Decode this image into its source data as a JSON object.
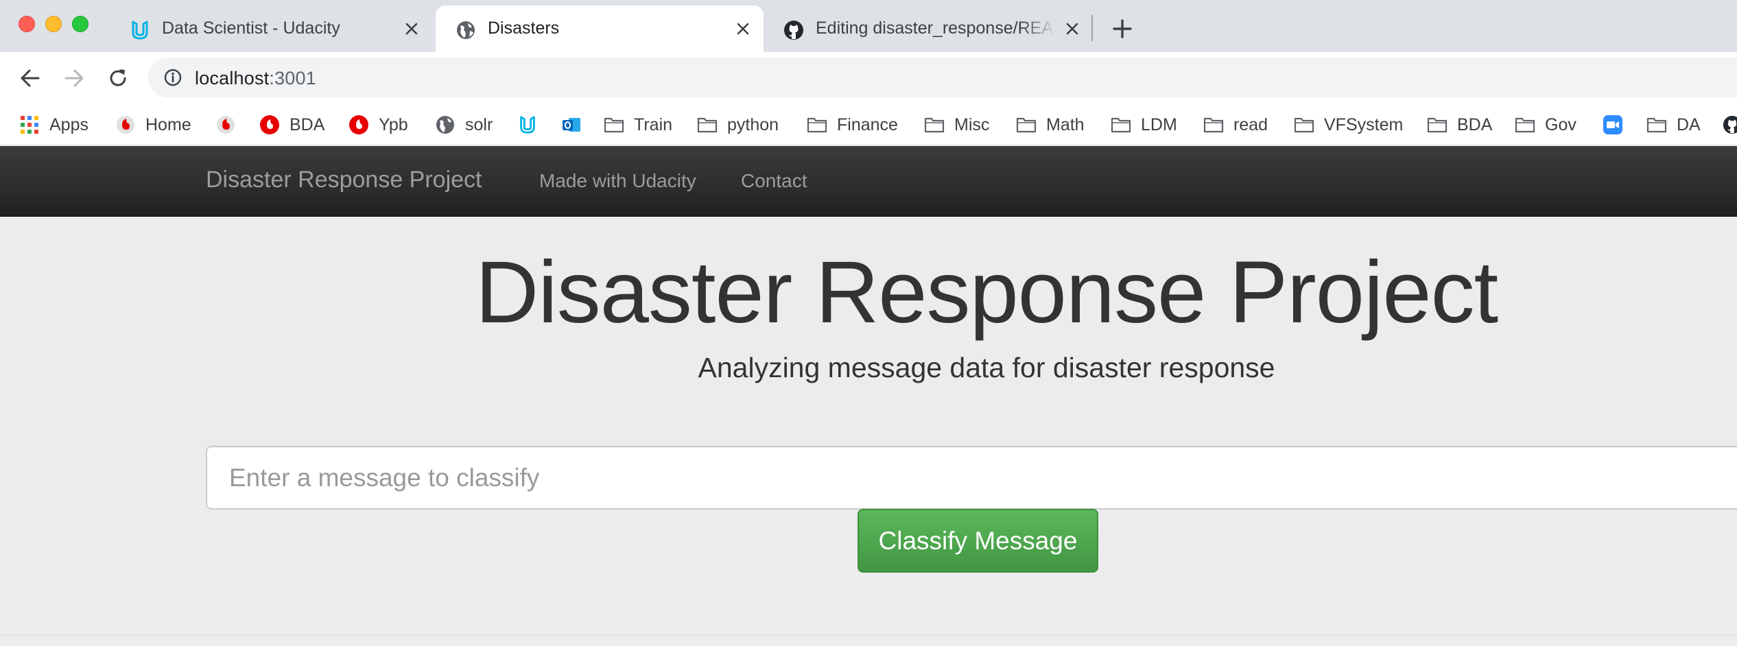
{
  "browser": {
    "tabs": [
      {
        "title": "Data Scientist - Udacity",
        "icon": "udacity-icon",
        "active": false
      },
      {
        "title": "Disasters",
        "icon": "globe-icon",
        "active": true
      },
      {
        "title": "Editing disaster_response/README.md",
        "icon": "github-icon",
        "active": false
      }
    ],
    "new_tab_label": "+",
    "url_host": "localhost",
    "url_port": ":3001",
    "bookmarks": [
      {
        "label": "Apps",
        "icon": "apps-grid-icon"
      },
      {
        "label": "Home",
        "icon": "vodafone-icon"
      },
      {
        "label": "",
        "icon": "vodafone-icon"
      },
      {
        "label": "BDA",
        "icon": "vodafone-icon"
      },
      {
        "label": "Ypb",
        "icon": "vodafone-icon"
      },
      {
        "label": "solr",
        "icon": "globe-icon"
      },
      {
        "label": "",
        "icon": "udacity-icon"
      },
      {
        "label": "",
        "icon": "outlook-icon"
      },
      {
        "label": "Train",
        "icon": "folder-icon"
      },
      {
        "label": "python",
        "icon": "folder-icon"
      },
      {
        "label": "Finance",
        "icon": "folder-icon"
      },
      {
        "label": "Misc",
        "icon": "folder-icon"
      },
      {
        "label": "Math",
        "icon": "folder-icon"
      },
      {
        "label": "LDM",
        "icon": "folder-icon"
      },
      {
        "label": "read",
        "icon": "folder-icon"
      },
      {
        "label": "VFSystem",
        "icon": "folder-icon"
      },
      {
        "label": "BDA",
        "icon": "folder-icon"
      },
      {
        "label": "Gov",
        "icon": "folder-icon"
      },
      {
        "label": "",
        "icon": "zoom-icon"
      },
      {
        "label": "DA",
        "icon": "folder-icon"
      },
      {
        "label": "",
        "icon": "github-icon"
      }
    ]
  },
  "page": {
    "navbar": {
      "brand": "Disaster Response Project",
      "links": [
        "Made with Udacity",
        "Contact"
      ]
    },
    "title": "Disaster Response Project",
    "subtitle": "Analyzing message data for disaster response",
    "input_placeholder": "Enter a message to classify",
    "button_label": "Classify Message"
  },
  "colors": {
    "navbar_bg": "#222222",
    "button_green": "#5cb85c",
    "page_bg": "#ececec"
  }
}
